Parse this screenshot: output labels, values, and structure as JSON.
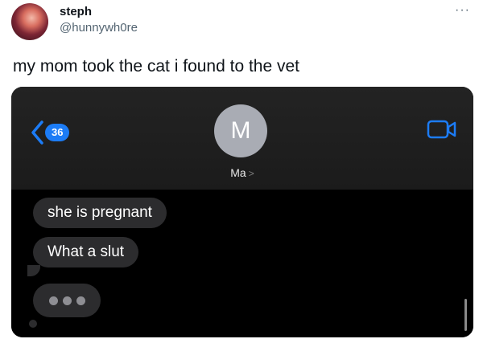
{
  "tweet": {
    "display_name": "steph",
    "handle": "@hunnywh0re",
    "more_label": "···",
    "text": "my mom took the cat i found to the vet"
  },
  "imessage": {
    "unread_count": "36",
    "contact_initial": "M",
    "contact_name": "Ma",
    "contact_chevron": ">",
    "accent_color": "#1c7cf6",
    "messages": [
      {
        "text": "she is pregnant"
      },
      {
        "text": "What a slut"
      }
    ],
    "typing_indicator": "typing"
  }
}
